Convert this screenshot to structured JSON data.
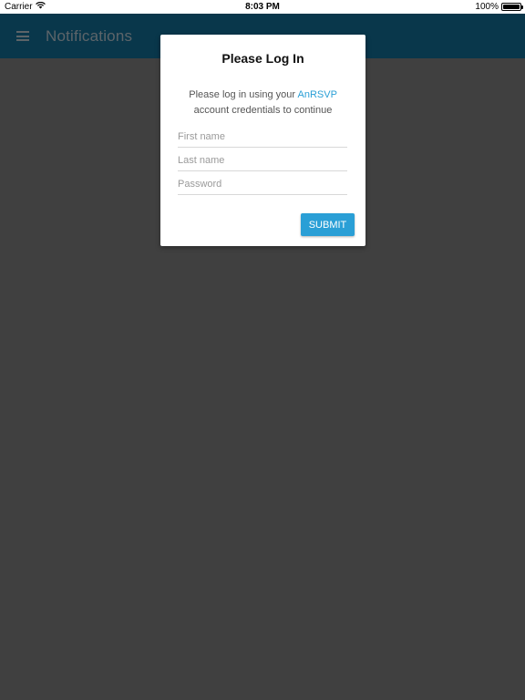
{
  "status_bar": {
    "carrier": "Carrier",
    "time": "8:03 PM",
    "battery_text": "100%",
    "battery_level": 1.0,
    "wifi_icon": "wifi-icon",
    "battery_icon": "battery-icon"
  },
  "app_bar": {
    "title": "Notifications",
    "menu_icon": "menu-icon",
    "color": "#136e96"
  },
  "dialog": {
    "title": "Please Log In",
    "message_before": "Please log in using your ",
    "link_text": "AnRSVP",
    "message_after": " account credentials to continue",
    "link_color": "#2a9fd6",
    "fields": {
      "first_name": {
        "value": "",
        "placeholder": "First name"
      },
      "last_name": {
        "value": "",
        "placeholder": "Last name"
      },
      "password": {
        "value": "",
        "placeholder": "Password"
      }
    },
    "submit_label": "SUBMIT",
    "submit_color": "#2a9fd6"
  }
}
